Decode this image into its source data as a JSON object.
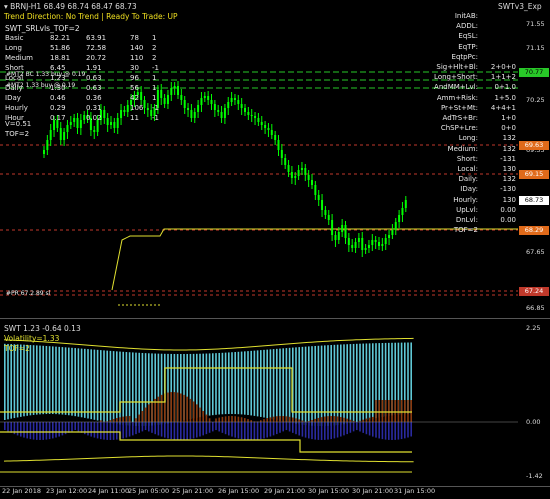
{
  "title": {
    "symbol": "BRNJ-H1",
    "ohlc": "68.49 68.74 68.47 68.73",
    "indicator": "SWTv3_Exp"
  },
  "status": {
    "trend_label": "Trend Direction:",
    "trend_value": "No Trend",
    "sep": "|",
    "ready_label": "Ready To Trade:",
    "ready_value": "UP"
  },
  "left_panel": {
    "header": "SWT_SRLvls_TOF=2",
    "rows": [
      {
        "label": "Basic",
        "c1": "82.21",
        "c2": "63.91",
        "c3": "78",
        "c4": "1"
      },
      {
        "label": "Long",
        "c1": "51.86",
        "c2": "72.58",
        "c3": "140",
        "c4": "2"
      },
      {
        "label": "Medium",
        "c1": "18.81",
        "c2": "20.72",
        "c3": "110",
        "c4": "2"
      },
      {
        "label": "Short",
        "c1": "6.45",
        "c2": "1.91",
        "c3": "30",
        "c4": "-1"
      },
      {
        "label": "Local",
        "c1": "1.23",
        "c2": "0.63",
        "c3": "96",
        "c4": "1"
      },
      {
        "label": "Daily",
        "c1": "1.30",
        "c2": "0.63",
        "c3": "56",
        "c4": "1"
      },
      {
        "label": "IDay",
        "c1": "0.46",
        "c2": "0.36",
        "c3": "42",
        "c4": "1"
      },
      {
        "label": "Hourly",
        "c1": "0.29",
        "c2": "0.31",
        "c3": "106",
        "c4": "-1"
      },
      {
        "label": "IHour",
        "c1": "0.17",
        "c2": "0.02",
        "c3": "11",
        "c4": "-1"
      }
    ],
    "v_line": "V=0.51",
    "tof_line": "TOF=2",
    "overlay1": "#MT2 BC 1.33 buy @ 0.19",
    "overlay2": "#MT2 1.33 buy @ 0.19",
    "low_label": "#PR 67.2.89 sl"
  },
  "right_panel": {
    "rows": [
      {
        "label": "InitAB:",
        "value": ""
      },
      {
        "label": "ADDL:",
        "value": ""
      },
      {
        "label": "EqSL:",
        "value": ""
      },
      {
        "label": "EqTP:",
        "value": ""
      },
      {
        "label": "EqtpPc:",
        "value": ""
      },
      {
        "label": "Sig+Hlt+Bl:",
        "value": "2+0+0"
      },
      {
        "label": "Long+Short:",
        "value": "1+1+2"
      },
      {
        "label": "AndMM+Lvl:",
        "value": "0+1.0"
      },
      {
        "label": "Amm+Risk:",
        "value": "1+5.0"
      },
      {
        "label": "Pr+St+Mt:",
        "value": "4+4+1"
      },
      {
        "label": "AdTrS+Br:",
        "value": "1+0"
      },
      {
        "label": "ChSP+Lre:",
        "value": "0+0"
      },
      {
        "label": "Long:",
        "value": "132"
      },
      {
        "label": "Medium:",
        "value": "132"
      },
      {
        "label": "Short:",
        "value": "-131"
      },
      {
        "label": "Local:",
        "value": "130"
      },
      {
        "label": "Daily:",
        "value": "132"
      },
      {
        "label": "IDay:",
        "value": "-130"
      },
      {
        "label": "Hourly:",
        "value": "130"
      },
      {
        "label": "UpLvl:",
        "value": "0.00"
      },
      {
        "label": "DnLvl:",
        "value": "0.00"
      },
      {
        "label": "TOF=2",
        "value": ""
      }
    ]
  },
  "price_axis": [
    "71.55",
    "71.15",
    "70.25",
    "69.35",
    "68.40",
    "67.65",
    "66.85"
  ],
  "price_tags": [
    {
      "text": "70.77",
      "color": "#28c828",
      "text_color": "#000000"
    },
    {
      "text": "69.63",
      "color": "#e06a1a",
      "text_color": "#ffffff"
    },
    {
      "text": "69.15",
      "color": "#e06a1a",
      "text_color": "#ffffff"
    },
    {
      "text": "68.73",
      "color": "#ffffff",
      "text_color": "#000000"
    },
    {
      "text": "68.29",
      "color": "#e06a1a",
      "text_color": "#ffffff"
    },
    {
      "text": "67.24",
      "color": "#c0392b",
      "text_color": "#ffffff"
    }
  ],
  "osc": {
    "title": "SWT 1.23 -0.64 0.13",
    "volatility": "Volatility=1.33",
    "tof": "TOF=2",
    "axis": [
      "2.25",
      "0.00",
      "-1.42"
    ]
  },
  "x_axis": [
    "22 Jan 2018",
    "23 Jan 12:00",
    "24 Jan 11:00",
    "25 Jan 05:00",
    "25 Jan 21:00",
    "26 Jan 15:00",
    "29 Jan 21:00",
    "30 Jan 15:00",
    "30 Jan 21:00",
    "31 Jan 15:00"
  ],
  "colors": {
    "background": "#000000",
    "candle_up": "#00ff00",
    "candle_down": "#00ff00",
    "level_yellow": "#e0e030",
    "level_red": "#c0392b",
    "hist_cyan": "#5fc8d6",
    "hist_brown": "#8a3a10"
  }
}
